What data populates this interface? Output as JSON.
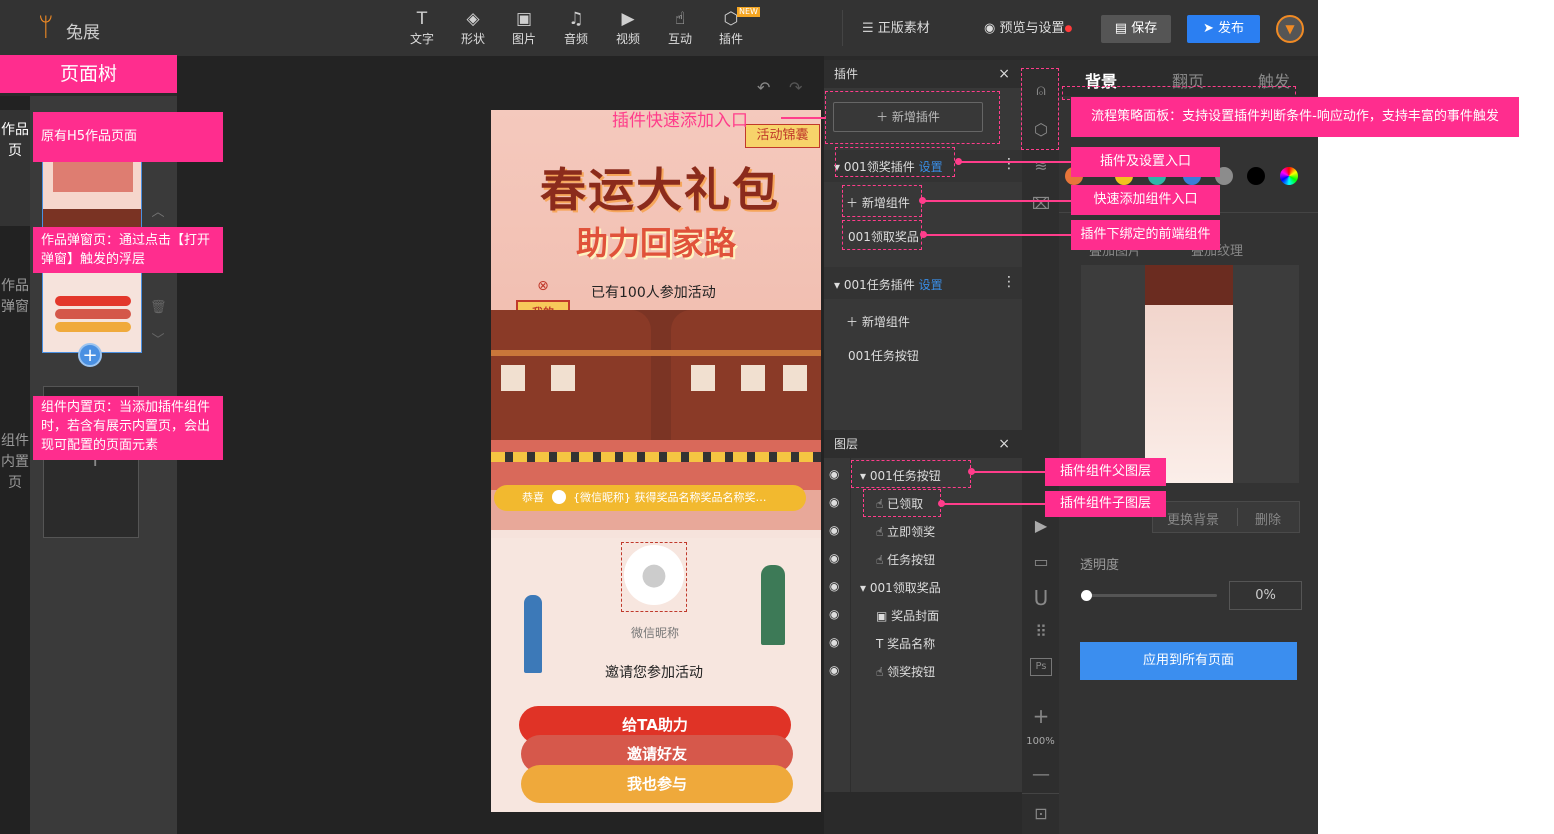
{
  "app": {
    "logo_text": "兔展"
  },
  "toolbar": {
    "tools": [
      {
        "label": "文字",
        "icon": "text-icon",
        "glyph": "T"
      },
      {
        "label": "形状",
        "icon": "shape-icon",
        "glyph": "◈"
      },
      {
        "label": "图片",
        "icon": "image-icon",
        "glyph": "▣"
      },
      {
        "label": "音频",
        "icon": "music-icon",
        "glyph": "♫"
      },
      {
        "label": "视频",
        "icon": "video-icon",
        "glyph": "▶"
      },
      {
        "label": "互动",
        "icon": "hand-icon",
        "glyph": "☝"
      },
      {
        "label": "插件",
        "icon": "cube-icon",
        "glyph": "⬡"
      }
    ],
    "new_badge": "NEW",
    "licensed_assets": "正版素材",
    "preview": "预览与设置",
    "save": "保存",
    "publish": "发布"
  },
  "page_tree": {
    "title": "页面树",
    "tabs": [
      "作品页",
      "作品弹窗",
      "组件内置页"
    ],
    "add_symbol": "+"
  },
  "phone": {
    "tag": "活动锦囊",
    "title1": "春运大礼包",
    "title2": "助力回家路",
    "participants": "已有100人参加活动",
    "gift": "我的奖品",
    "ticker_prefix": "恭喜",
    "ticker": "{微信昵称} 获得奖品名称奖品名称奖…",
    "nickname": "微信昵称",
    "invite_text": "邀请您参加活动",
    "btn_help": "给TA助力",
    "btn_invite": "邀请好友",
    "btn_join": "我也参与"
  },
  "plugin_panel": {
    "title": "插件",
    "close": "×",
    "add_plugin": "新增插件",
    "plugins": [
      {
        "name": "001领奖插件",
        "settings": "设置",
        "add_component": "新增组件",
        "components": [
          "001领取奖品"
        ]
      },
      {
        "name": "001任务插件",
        "settings": "设置",
        "add_component": "新增组件",
        "components": [
          "001任务按钮"
        ]
      }
    ]
  },
  "layer_panel": {
    "title": "图层",
    "close": "×",
    "layers": [
      {
        "label": "001任务按钮",
        "level": 0,
        "expanded": true
      },
      {
        "label": "已领取",
        "level": 1
      },
      {
        "label": "立即领奖",
        "level": 1
      },
      {
        "label": "任务按钮",
        "level": 1
      },
      {
        "label": "001领取奖品",
        "level": 0,
        "expanded": true
      },
      {
        "label": "奖品封面",
        "level": 1
      },
      {
        "label": "奖品名称",
        "level": 1
      },
      {
        "label": "领奖按钮",
        "level": 1
      }
    ]
  },
  "side_strip": {
    "zoom": "100%"
  },
  "right_panel": {
    "tabs": [
      "背景",
      "翻页",
      "触发"
    ],
    "sub_tabs": [
      "叠加图片",
      "叠加纹理"
    ],
    "replace_bg": "更换背景",
    "delete": "删除",
    "opacity_label": "透明度",
    "opacity_value": "0%",
    "opacity": 0,
    "apply_all": "应用到所有页面",
    "colors": [
      "#e8763a",
      "#f2c31f",
      "#2fb5a8",
      "#3b7dd8",
      "#8c8c8c",
      "#000000"
    ]
  },
  "annotations": {
    "original_page": "原有H5作品页面",
    "popup_page": "作品弹窗页：通过点击【打开弹窗】触发的浮层",
    "builtin_page": "组件内置页：当添加插件组件时，若含有展示内置页，会出现可配置的页面元素",
    "quick_add_plugin": "插件快速添加入口",
    "flow_panel": "流程策略面板：支持设置插件判断条件-响应动作，支持丰富的事件触发",
    "plugin_settings": "插件及设置入口",
    "quick_add_component": "快速添加组件入口",
    "bound_component": "插件下绑定的前端组件",
    "parent_layer": "插件组件父图层",
    "child_layer": "插件组件子图层"
  },
  "colors": {
    "accent": "#ff2d8e",
    "primary": "#2b7ff2"
  }
}
